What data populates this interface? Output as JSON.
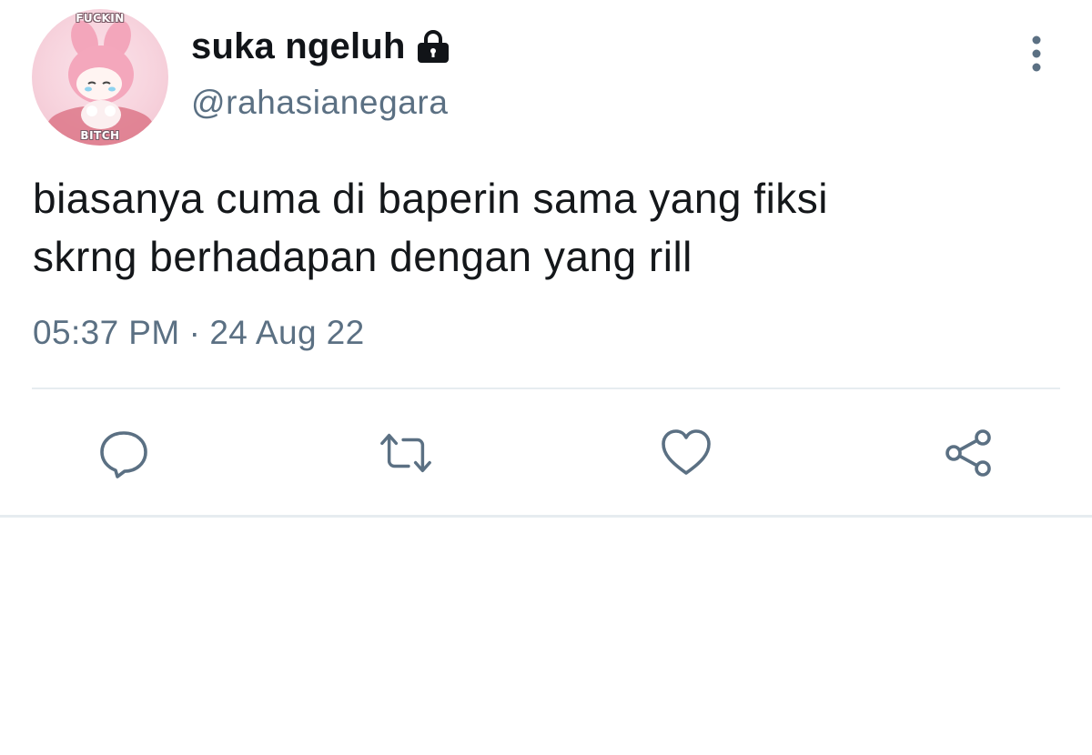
{
  "avatar": {
    "overlay_top": "FUCKIN",
    "overlay_bottom": "BITCH",
    "icon": "my-melody-avatar"
  },
  "user": {
    "display_name": "suka ngeluh",
    "handle": "@rahasianegara",
    "protected_icon": "lock-icon"
  },
  "tweet": {
    "lines": [
      "biasanya cuma di baperin sama yang fiksi",
      "skrng berhadapan dengan yang rill"
    ],
    "time": "05:37 PM",
    "separator": "·",
    "date": "24 Aug 22"
  },
  "actions": {
    "icons": [
      "reply-icon",
      "retweet-icon",
      "like-icon",
      "share-icon"
    ]
  },
  "colors": {
    "text_primary": "#14171a",
    "text_secondary": "#5b7083",
    "icon": "#5b7083",
    "divider": "#e6ecf0"
  }
}
